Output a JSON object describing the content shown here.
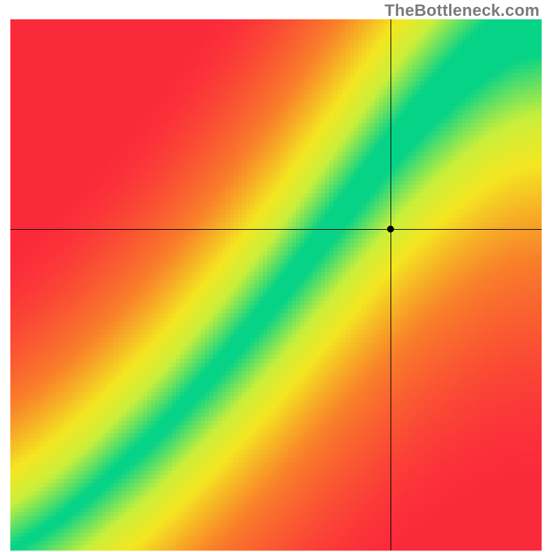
{
  "watermark": "TheBottleneck.com",
  "chart_data": {
    "type": "heatmap",
    "title": "",
    "xlabel": "",
    "ylabel": "",
    "x_range": [
      0,
      1
    ],
    "y_range": [
      0,
      1
    ],
    "crosshair": {
      "x": 0.715,
      "y": 0.605
    },
    "marker": {
      "x": 0.715,
      "y": 0.605
    },
    "ridge_points": [
      {
        "x": 0.0,
        "y": 0.0
      },
      {
        "x": 0.05,
        "y": 0.03
      },
      {
        "x": 0.1,
        "y": 0.065
      },
      {
        "x": 0.15,
        "y": 0.105
      },
      {
        "x": 0.2,
        "y": 0.15
      },
      {
        "x": 0.25,
        "y": 0.195
      },
      {
        "x": 0.3,
        "y": 0.245
      },
      {
        "x": 0.35,
        "y": 0.3
      },
      {
        "x": 0.4,
        "y": 0.355
      },
      {
        "x": 0.45,
        "y": 0.415
      },
      {
        "x": 0.5,
        "y": 0.475
      },
      {
        "x": 0.55,
        "y": 0.54
      },
      {
        "x": 0.6,
        "y": 0.605
      },
      {
        "x": 0.65,
        "y": 0.67
      },
      {
        "x": 0.7,
        "y": 0.735
      },
      {
        "x": 0.75,
        "y": 0.795
      },
      {
        "x": 0.8,
        "y": 0.85
      },
      {
        "x": 0.85,
        "y": 0.9
      },
      {
        "x": 0.9,
        "y": 0.945
      },
      {
        "x": 0.95,
        "y": 0.98
      },
      {
        "x": 1.0,
        "y": 1.0
      }
    ],
    "ridge_half_width": [
      0.012,
      0.014,
      0.017,
      0.02,
      0.023,
      0.027,
      0.03,
      0.034,
      0.038,
      0.042,
      0.047,
      0.052,
      0.057,
      0.063,
      0.069,
      0.075,
      0.082,
      0.09,
      0.098,
      0.108,
      0.118
    ],
    "color_stops": {
      "red": "#fb2a3b",
      "orange": "#f97f2a",
      "yellow": "#f4e621",
      "yellowgreen": "#c9ef3b",
      "green": "#07d387"
    },
    "description": "Heatmap-style background: value drops from 1 (green) on a curved diagonal ridge down to 0 (red) away from it. Ridge widens toward top-right. A black crosshair and dot mark a point slightly below the ridge in the upper-right region."
  }
}
